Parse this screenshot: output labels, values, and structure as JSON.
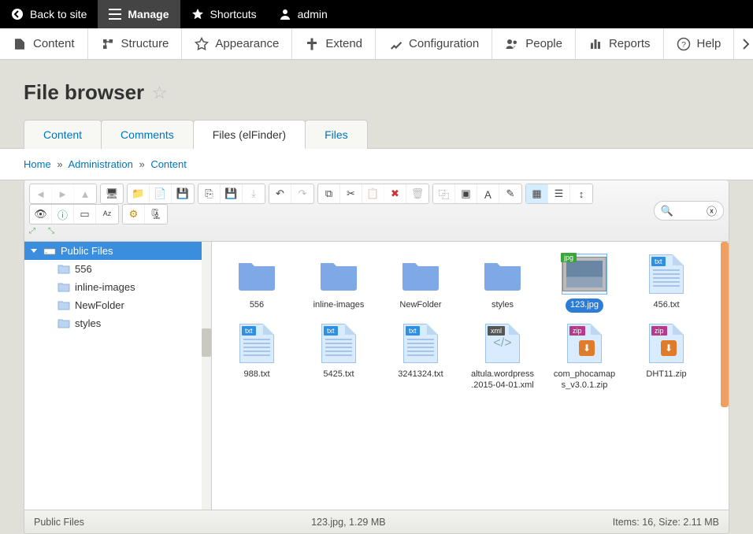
{
  "topbar": {
    "back": "Back to site",
    "manage": "Manage",
    "shortcuts": "Shortcuts",
    "user": "admin"
  },
  "menubar": {
    "content": "Content",
    "structure": "Structure",
    "appearance": "Appearance",
    "extend": "Extend",
    "configuration": "Configuration",
    "people": "People",
    "reports": "Reports",
    "help": "Help"
  },
  "page_title": "File browser",
  "tabs": {
    "content": "Content",
    "comments": "Comments",
    "files_elfinder": "Files (elFinder)",
    "files": "Files"
  },
  "breadcrumb": {
    "home": "Home",
    "admin": "Administration",
    "content": "Content"
  },
  "search_placeholder": "",
  "tree": {
    "root": "Public Files",
    "children": [
      "556",
      "inline-images",
      "NewFolder",
      "styles"
    ]
  },
  "files": [
    {
      "name": "556",
      "type": "folder"
    },
    {
      "name": "inline-images",
      "type": "folder"
    },
    {
      "name": "NewFolder",
      "type": "folder"
    },
    {
      "name": "styles",
      "type": "folder"
    },
    {
      "name": "123.jpg",
      "type": "jpg",
      "selected": true
    },
    {
      "name": "456.txt",
      "type": "txt"
    },
    {
      "name": "988.txt",
      "type": "txt"
    },
    {
      "name": "5425.txt",
      "type": "txt"
    },
    {
      "name": "3241324.txt",
      "type": "txt"
    },
    {
      "name": "altula.wordpress.2015-04-01.xml",
      "type": "xml"
    },
    {
      "name": "com_phocamaps_v3.0.1.zip",
      "type": "zip"
    },
    {
      "name": "DHT11.zip",
      "type": "zip"
    }
  ],
  "status": {
    "path": "Public Files",
    "selection": "123.jpg, 1.29 MB",
    "summary": "Items: 16, Size: 2.11 MB"
  }
}
